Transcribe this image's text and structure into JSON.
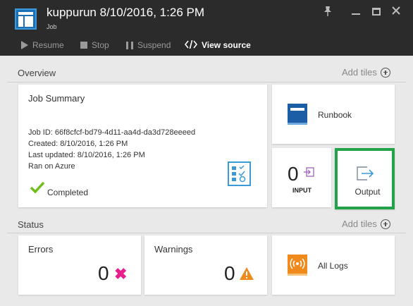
{
  "header": {
    "title": "kuppurun 8/10/2016, 1:26 PM",
    "subtitle": "Job"
  },
  "commands": {
    "resume": "Resume",
    "stop": "Stop",
    "suspend": "Suspend",
    "view_source": "View source"
  },
  "overview": {
    "label": "Overview",
    "add_tiles": "Add tiles"
  },
  "job_summary": {
    "title": "Job Summary",
    "job_id": "Job ID: 66f8cfcf-bd79-4d11-aa4d-da3d728eeeed",
    "created": "Created: 8/10/2016, 1:26 PM",
    "last_updated": "Last updated: 8/10/2016, 1:26 PM",
    "ran_on": "Ran on Azure",
    "status": "Completed"
  },
  "runbook": {
    "label": "Runbook"
  },
  "input": {
    "count": "0",
    "label": "INPUT"
  },
  "output": {
    "label": "Output"
  },
  "status_section": {
    "label": "Status",
    "add_tiles": "Add tiles"
  },
  "errors": {
    "label": "Errors",
    "count": "0"
  },
  "warnings": {
    "label": "Warnings",
    "count": "0"
  },
  "all_logs": {
    "label": "All Logs"
  },
  "colors": {
    "header_bg": "#2b2b2b",
    "accent_blue": "#1b6fb5",
    "output_border": "#22a34a",
    "error": "#e61f8c",
    "warning": "#f08a1c",
    "success": "#6fbe1a"
  }
}
